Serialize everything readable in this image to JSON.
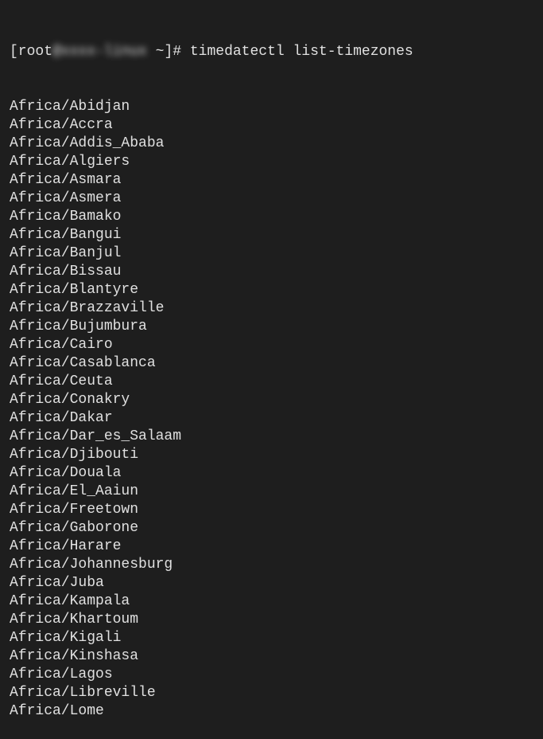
{
  "prompt": {
    "prefix": "[root",
    "hostname_obscured": "@xxxx-linux",
    "suffix": " ~]# ",
    "command": "timedatectl list-timezones"
  },
  "output": [
    "Africa/Abidjan",
    "Africa/Accra",
    "Africa/Addis_Ababa",
    "Africa/Algiers",
    "Africa/Asmara",
    "Africa/Asmera",
    "Africa/Bamako",
    "Africa/Bangui",
    "Africa/Banjul",
    "Africa/Bissau",
    "Africa/Blantyre",
    "Africa/Brazzaville",
    "Africa/Bujumbura",
    "Africa/Cairo",
    "Africa/Casablanca",
    "Africa/Ceuta",
    "Africa/Conakry",
    "Africa/Dakar",
    "Africa/Dar_es_Salaam",
    "Africa/Djibouti",
    "Africa/Douala",
    "Africa/El_Aaiun",
    "Africa/Freetown",
    "Africa/Gaborone",
    "Africa/Harare",
    "Africa/Johannesburg",
    "Africa/Juba",
    "Africa/Kampala",
    "Africa/Khartoum",
    "Africa/Kigali",
    "Africa/Kinshasa",
    "Africa/Lagos",
    "Africa/Libreville",
    "Africa/Lome"
  ]
}
